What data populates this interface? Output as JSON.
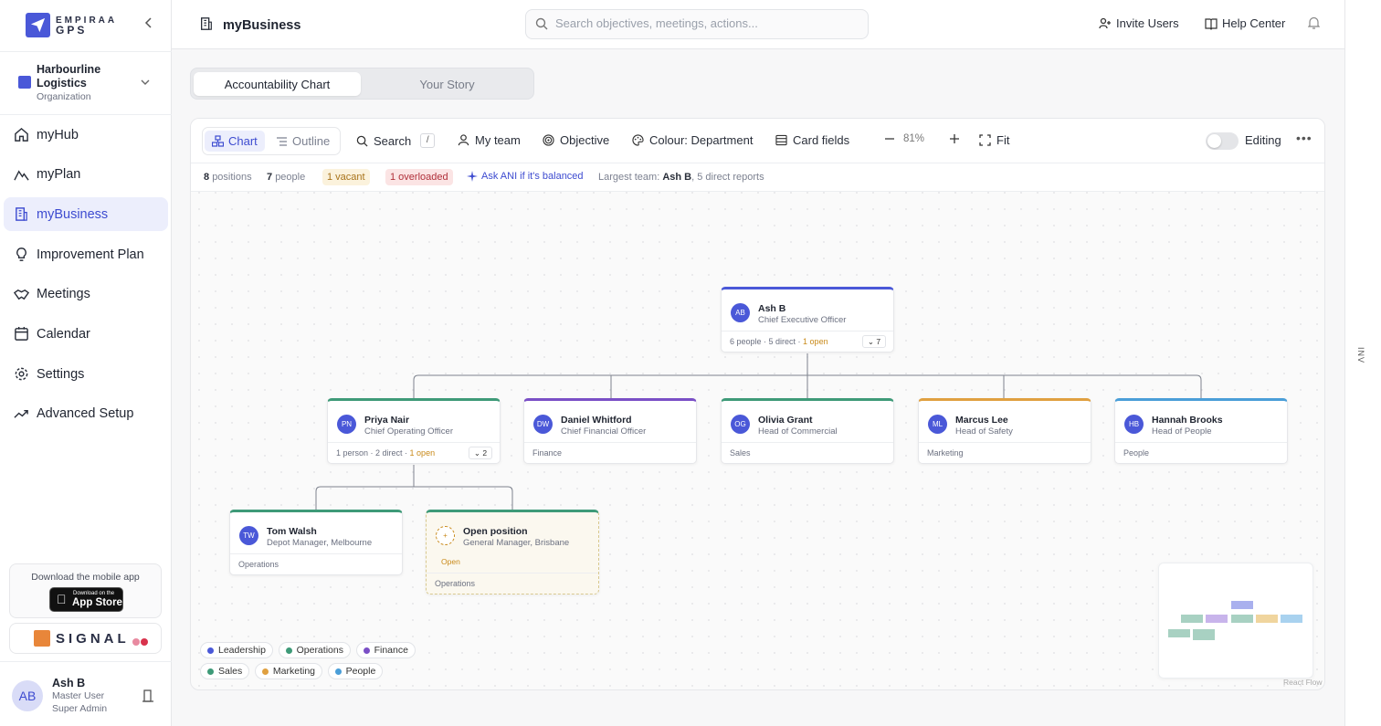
{
  "sidebar": {
    "brand_top": "EMPIRAA",
    "brand_bottom": "GPS",
    "org_name": "Harbourline Logistics",
    "org_type": "Organization",
    "items": [
      {
        "label": "myHub",
        "icon": "home-icon"
      },
      {
        "label": "myPlan",
        "icon": "mountain-icon"
      },
      {
        "label": "myBusiness",
        "icon": "building-icon",
        "active": true
      },
      {
        "label": "Improvement Plan",
        "icon": "lightbulb-icon"
      },
      {
        "label": "Meetings",
        "icon": "handshake-icon"
      },
      {
        "label": "Calendar",
        "icon": "calendar-icon"
      },
      {
        "label": "Settings",
        "icon": "gear-icon"
      },
      {
        "label": "Advanced Setup",
        "icon": "trend-icon"
      }
    ],
    "mobile_text": "Download the mobile app",
    "appstore_small": "Download on the",
    "appstore_big": "App Store",
    "signal_text": "SIGNAL",
    "user_initials": "AB",
    "user_name": "Ash B",
    "user_role": "Master User",
    "user_role2": "Super Admin"
  },
  "header": {
    "title": "myBusiness",
    "search_placeholder": "Search objectives, meetings, actions...",
    "invite": "Invite Users",
    "help": "Help Center"
  },
  "right_strip": "INV",
  "tabs": [
    "Accountability Chart",
    "Your Story"
  ],
  "toolbar": {
    "chart": "Chart",
    "outline": "Outline",
    "search": "Search",
    "search_key": "/",
    "my_team": "My team",
    "objective": "Objective",
    "colour": "Colour: Department",
    "card_fields": "Card fields",
    "zoom": "81%",
    "fit": "Fit",
    "editing": "Editing"
  },
  "stats": {
    "positions_n": "8",
    "positions": "positions",
    "people_n": "7",
    "people": "people",
    "vacant": "1 vacant",
    "overloaded": "1 overloaded",
    "ask": "Ask ANI if it's balanced",
    "largest_label": "Largest team:",
    "largest_name": "Ash B",
    "largest_rest": ", 5 direct reports"
  },
  "cards": {
    "ceo": {
      "initials": "AB",
      "name": "Ash B",
      "role": "Chief Executive Officer",
      "footer": "6 people · 5 direct · ",
      "open": "1 open",
      "count": "7"
    },
    "coo": {
      "initials": "PN",
      "name": "Priya Nair",
      "role": "Chief Operating Officer",
      "footer": "1 person · 2 direct · ",
      "open": "1 open",
      "count": "2"
    },
    "cfo": {
      "initials": "DW",
      "name": "Daniel Whitford",
      "role": "Chief Financial Officer",
      "footer": "Finance"
    },
    "com": {
      "initials": "OG",
      "name": "Olivia Grant",
      "role": "Head of Commercial",
      "footer": "Sales"
    },
    "saf": {
      "initials": "ML",
      "name": "Marcus Lee",
      "role": "Head of Safety",
      "footer": "Marketing"
    },
    "ppl": {
      "initials": "HB",
      "name": "Hannah Brooks",
      "role": "Head of People",
      "footer": "People"
    },
    "dep": {
      "initials": "TW",
      "name": "Tom Walsh",
      "role": "Depot Manager, Melbourne",
      "footer": "Operations"
    },
    "vac": {
      "initials": "+",
      "name": "Open position",
      "role": "General Manager, Brisbane",
      "tag": "Open",
      "footer": "Operations"
    }
  },
  "legend": [
    {
      "label": "Leadership",
      "color": "#4a58d8"
    },
    {
      "label": "Operations",
      "color": "#3e9a78"
    },
    {
      "label": "Finance",
      "color": "#7a4fc6"
    },
    {
      "label": "Sales",
      "color": "#3e9a78"
    },
    {
      "label": "Marketing",
      "color": "#e0a040"
    },
    {
      "label": "People",
      "color": "#4a9ed8"
    }
  ],
  "react_flow": "React Flow"
}
